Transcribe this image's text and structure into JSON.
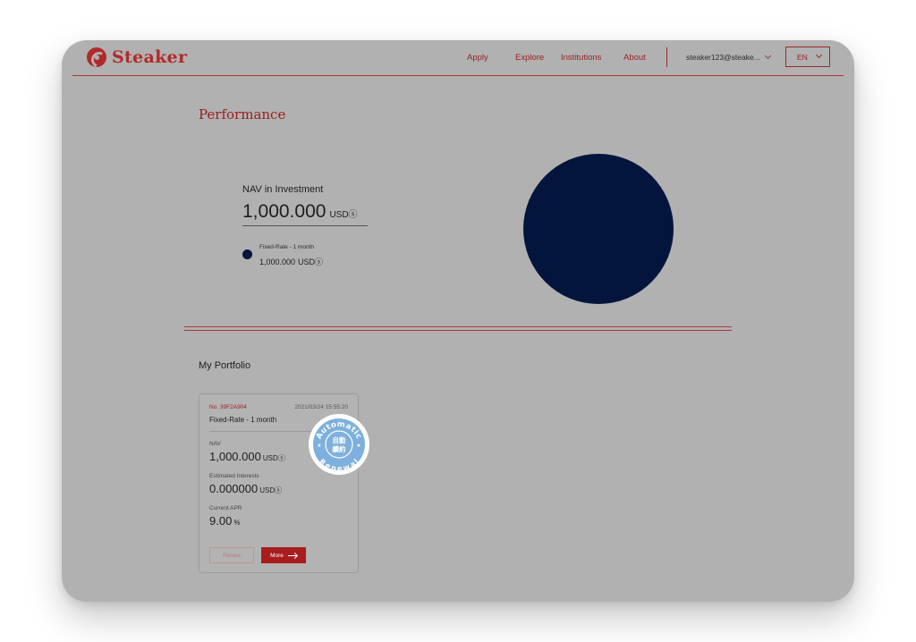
{
  "brand": {
    "name": "Steaker",
    "color": "#b02a2a"
  },
  "nav": {
    "apply": "Apply",
    "explore": "Explore",
    "institutions": "Institutions",
    "about": "About"
  },
  "account": {
    "email": "steaker123@steake..."
  },
  "language": {
    "selected": "EN"
  },
  "performance": {
    "title": "Performance",
    "nav_label": "NAV in Investment",
    "nav_value": "1,000.000",
    "unit": "USDⓢ",
    "legend": [
      {
        "label": "Fixed-Rate - 1 month",
        "value": "1,000.000",
        "unit": "USDⓢ",
        "color": "#04153d"
      }
    ]
  },
  "chart_data": {
    "type": "pie",
    "categories": [
      "Fixed-Rate - 1 month"
    ],
    "values": [
      1000.0
    ],
    "colors": [
      "#04153d"
    ]
  },
  "portfolio": {
    "title": "My Portfolio",
    "cards": [
      {
        "number": "No. 39F2A904",
        "date": "2021/03/24 15:55:20",
        "plan": "Fixed-Rate - 1 month",
        "nav_label": "NAV",
        "nav_value": "1,000.000",
        "nav_unit": "USDⓢ",
        "interest_label": "Estimated Interests",
        "interest_value": "0.000000",
        "interest_unit": "USDⓢ",
        "apr_label": "Current APR",
        "apr_value": "9.00",
        "apr_unit": "%",
        "renew_label": "Renew",
        "more_label": "More",
        "badge": {
          "top": "Automatic",
          "bottom": "Renewal",
          "center_line1": "自動",
          "center_line2": "續約",
          "color": "#7eb0dd"
        }
      }
    ]
  }
}
